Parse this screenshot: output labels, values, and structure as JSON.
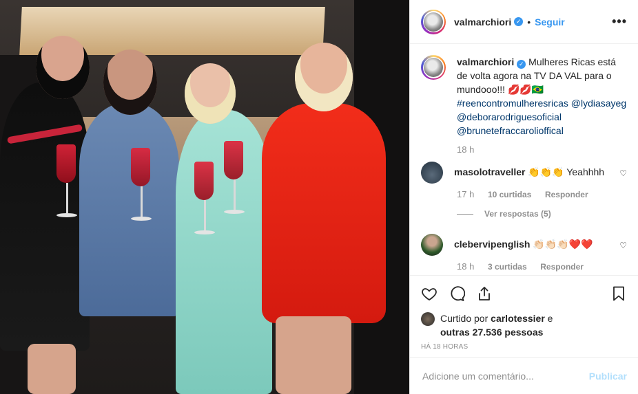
{
  "post": {
    "username": "valmarchiori",
    "follow_label": "Seguir",
    "more_label": "•••"
  },
  "caption": {
    "username": "valmarchiori",
    "text": "Mulheres Ricas está de volta agora na TV DA VAL para o mundooo!!! 💋💋🇧🇷",
    "hashtags": [
      "#reencontromulheresricas @lydiasayeg",
      "@deborarodriguesoficial",
      "@brunetefraccarolioffical"
    ],
    "time": "18 h"
  },
  "comments": [
    {
      "username": "masolotraveller",
      "text": "👏👏👏 Yeahhhh",
      "time": "17 h",
      "likes": "10 curtidas",
      "reply": "Responder",
      "view_replies": "Ver respostas (5)"
    },
    {
      "username": "clebervipenglish",
      "text": "👏🏻👏🏻👏🏻❤️❤️",
      "time": "18 h",
      "likes": "3 curtidas",
      "reply": "Responder"
    }
  ],
  "likes": {
    "prefix": "Curtido por",
    "user": "carlotessier",
    "and": "e",
    "others": "outras 27.536 pessoas",
    "time_ago": "HÁ 18 HORAS"
  },
  "add_comment": {
    "placeholder": "Adicione um comentário...",
    "publish_label": "Publicar"
  },
  "colors": {
    "link_blue": "#3897f0",
    "publish_disabled": "#b2dffc",
    "hashtag": "#00376b"
  }
}
